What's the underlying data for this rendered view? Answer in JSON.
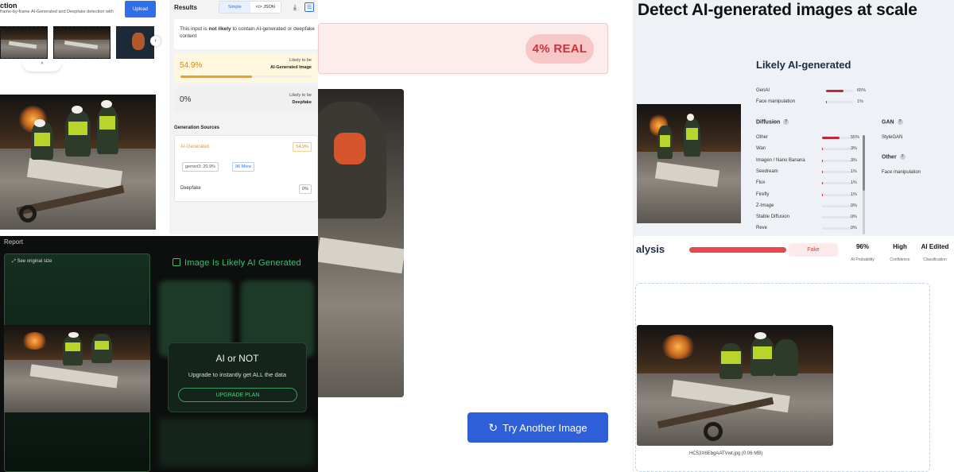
{
  "panel1": {
    "title": "ction",
    "subtitle": "frame-by-frame AI-Generated and Deepfake detection with",
    "upload_label": "Upload"
  },
  "results": {
    "header": "Results",
    "toggle_simple": "Simple",
    "toggle_json": "</> JSON",
    "summary": "This input is not likely to contain AI-generated or deepfake content",
    "summary_prefix": "This input is ",
    "summary_bold": "not likely",
    "summary_suffix": " to contain AI-generated or deepfake content",
    "ai_percent": "54.9%",
    "ai_label_top": "Likely to be",
    "ai_label_bottom": "AI-Generated Image",
    "ai_fraction": 0.549,
    "df_percent": "0%",
    "df_label_top": "Likely to be",
    "df_label_bottom": "Deepfake",
    "gen_sources_title": "Generation Sources",
    "src_ai_label": "AI-Generated",
    "src_ai_value": "54.9%",
    "src_tag1": "gemini3: 20.9%",
    "src_tag2": "96 More",
    "src_df_label": "Deepfake",
    "src_df_value": "0%"
  },
  "report": {
    "title": "Report",
    "see_original": "See original size",
    "likely_ai": "Image Is Likely AI Generated",
    "modal_title": "AI or NOT",
    "modal_sub": "Upgrade to instantly get ALL the data",
    "modal_button": "UPGRADE PLAN"
  },
  "mid": {
    "real_badge": "4% REAL",
    "try_button": "Try Another Image"
  },
  "right": {
    "headline": "Detect AI-generated images at scale",
    "likely": "Likely AI-generated",
    "top_rows": [
      {
        "label": "GenAI",
        "value": "65%",
        "fraction": 0.65
      },
      {
        "label": "Face manipulation",
        "value": "1%",
        "fraction": 0.01
      }
    ],
    "diffusion_title": "Diffusion",
    "diffusion_rows": [
      {
        "label": "Other",
        "value": "55%",
        "fraction": 0.55
      },
      {
        "label": "Wan",
        "value": "3%",
        "fraction": 0.03
      },
      {
        "label": "Imagen / Nano Banana",
        "value": "3%",
        "fraction": 0.03
      },
      {
        "label": "Seedream",
        "value": "1%",
        "fraction": 0.01
      },
      {
        "label": "Flux",
        "value": "1%",
        "fraction": 0.01
      },
      {
        "label": "Firefly",
        "value": "1%",
        "fraction": 0.01
      },
      {
        "label": "Z-Image",
        "value": "0%",
        "fraction": 0.0
      },
      {
        "label": "Stable Diffusion",
        "value": "0%",
        "fraction": 0.0
      },
      {
        "label": "Reve",
        "value": "0%",
        "fraction": 0.0
      }
    ],
    "gan_title": "GAN",
    "gan_row": "StyleGAN",
    "other_title": "Other",
    "other_row": "Face manipulation",
    "analysis_title": "alysis",
    "fake_label": "Fake",
    "stats": [
      {
        "value": "96%",
        "label": "AI Probability"
      },
      {
        "value": "High",
        "label": "Confidence"
      },
      {
        "value": "AI Edited",
        "label": "Classification"
      }
    ],
    "filename": "HC53X6EbgAATVwt.jpg (0.06 MB)"
  },
  "colors": {
    "upload_blue": "#2f6fe8",
    "ai_orange": "#e9a12a",
    "real_red": "#c8333b",
    "report_green": "#35c66e",
    "bar_red": "#c0283a"
  }
}
